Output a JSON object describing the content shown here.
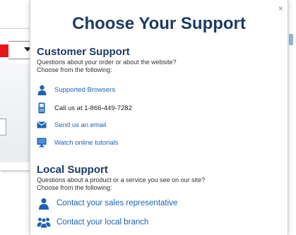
{
  "popup": {
    "close_glyph": "×",
    "title": "Choose Your Support"
  },
  "customer_support": {
    "heading": "Customer Support",
    "description_line1": "Questions about your order or about the website?",
    "description_line2": "Choose from the following:",
    "items": [
      {
        "label": "Supported Browsers",
        "icon": "person-icon",
        "link": true
      },
      {
        "label": "Call us at 1-866-449-7282",
        "icon": "phone-icon",
        "link": false
      },
      {
        "label": "Send us an email",
        "icon": "envelope-icon",
        "link": true
      },
      {
        "label": "Watch online tutorials",
        "icon": "monitor-icon",
        "link": true
      }
    ]
  },
  "local_support": {
    "heading": "Local Support",
    "description_line1": "Questions about a product or a service you see on our site?",
    "description_line2": "Choose from the following:",
    "items": [
      {
        "label": "Contact your sales representative",
        "icon": "person-icon",
        "link": true
      },
      {
        "label": "Contact your local branch",
        "icon": "group-icon",
        "link": true
      }
    ]
  },
  "colors": {
    "heading": "#1d3a66",
    "link": "#1d62b5",
    "icon": "#1d62b5",
    "background_select_accent": "#e8151b"
  }
}
